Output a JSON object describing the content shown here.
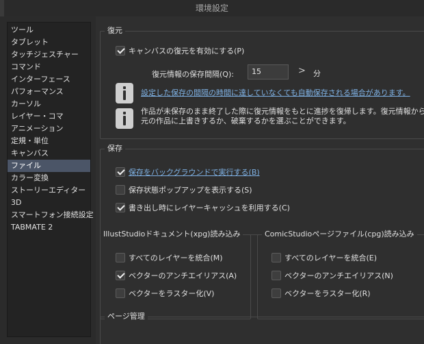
{
  "window": {
    "title": "環境設定"
  },
  "sidebar": {
    "items": [
      {
        "label": "ツール"
      },
      {
        "label": "タブレット"
      },
      {
        "label": "タッチジェスチャー"
      },
      {
        "label": "コマンド"
      },
      {
        "label": "インターフェース"
      },
      {
        "label": "パフォーマンス"
      },
      {
        "label": "カーソル"
      },
      {
        "label": "レイヤー・コマ"
      },
      {
        "label": "アニメーション"
      },
      {
        "label": "定規・単位"
      },
      {
        "label": "キャンバス"
      },
      {
        "label": "ファイル"
      },
      {
        "label": "カラー変換"
      },
      {
        "label": "ストーリーエディター"
      },
      {
        "label": "3D"
      },
      {
        "label": "スマートフォン接続設定"
      },
      {
        "label": "TABMATE 2"
      }
    ],
    "selected": "ファイル"
  },
  "restore": {
    "title": "復元",
    "enable_label": "キャンバスの復元を有効にする(P)",
    "enable_checked": true,
    "interval_label": "復元情報の保存間隔(Q):",
    "interval_value": "15",
    "interval_arrow": ">",
    "interval_unit": "分",
    "info1": "設定した保存の間隔の時間に達していなくても自動保存される場合があります。",
    "info2_line1": "作品が未保存のまま終了した際に復元情報をもとに進捗を復帰します。復元情報から",
    "info2_line2": "元の作品に上書きするか、破棄するかを選ぶことができます。"
  },
  "save": {
    "title": "保存",
    "background_label": "保存をバックグラウンドで実行する(B)",
    "background_checked": true,
    "popup_label": "保存状態ポップアップを表示する(S)",
    "popup_checked": false,
    "cache_label": "書き出し時にレイヤーキャッシュを利用する(C)",
    "cache_checked": true
  },
  "illust": {
    "title": "IllustStudioドキュメント(xpg)読み込み",
    "merge_label": "すべてのレイヤーを統合(M)",
    "merge_checked": false,
    "aa_label": "ベクターのアンチエイリアス(A)",
    "aa_checked": true,
    "raster_label": "ベクターをラスター化(V)",
    "raster_checked": false
  },
  "comic": {
    "title": "ComicStudioページファイル(cpg)読み込み",
    "merge_label": "すべてのレイヤーを統合(E)",
    "merge_checked": false,
    "aa_label": "ベクターのアンチエイリアス(N)",
    "aa_checked": false,
    "raster_label": "ベクターをラスター化(R)",
    "raster_checked": false
  },
  "page": {
    "title": "ページ管理"
  },
  "colors": {
    "background": "#2f2f2f",
    "sidebar_bg": "#232323",
    "selected_bg": "#4b5567",
    "link": "#7fb2e5"
  }
}
